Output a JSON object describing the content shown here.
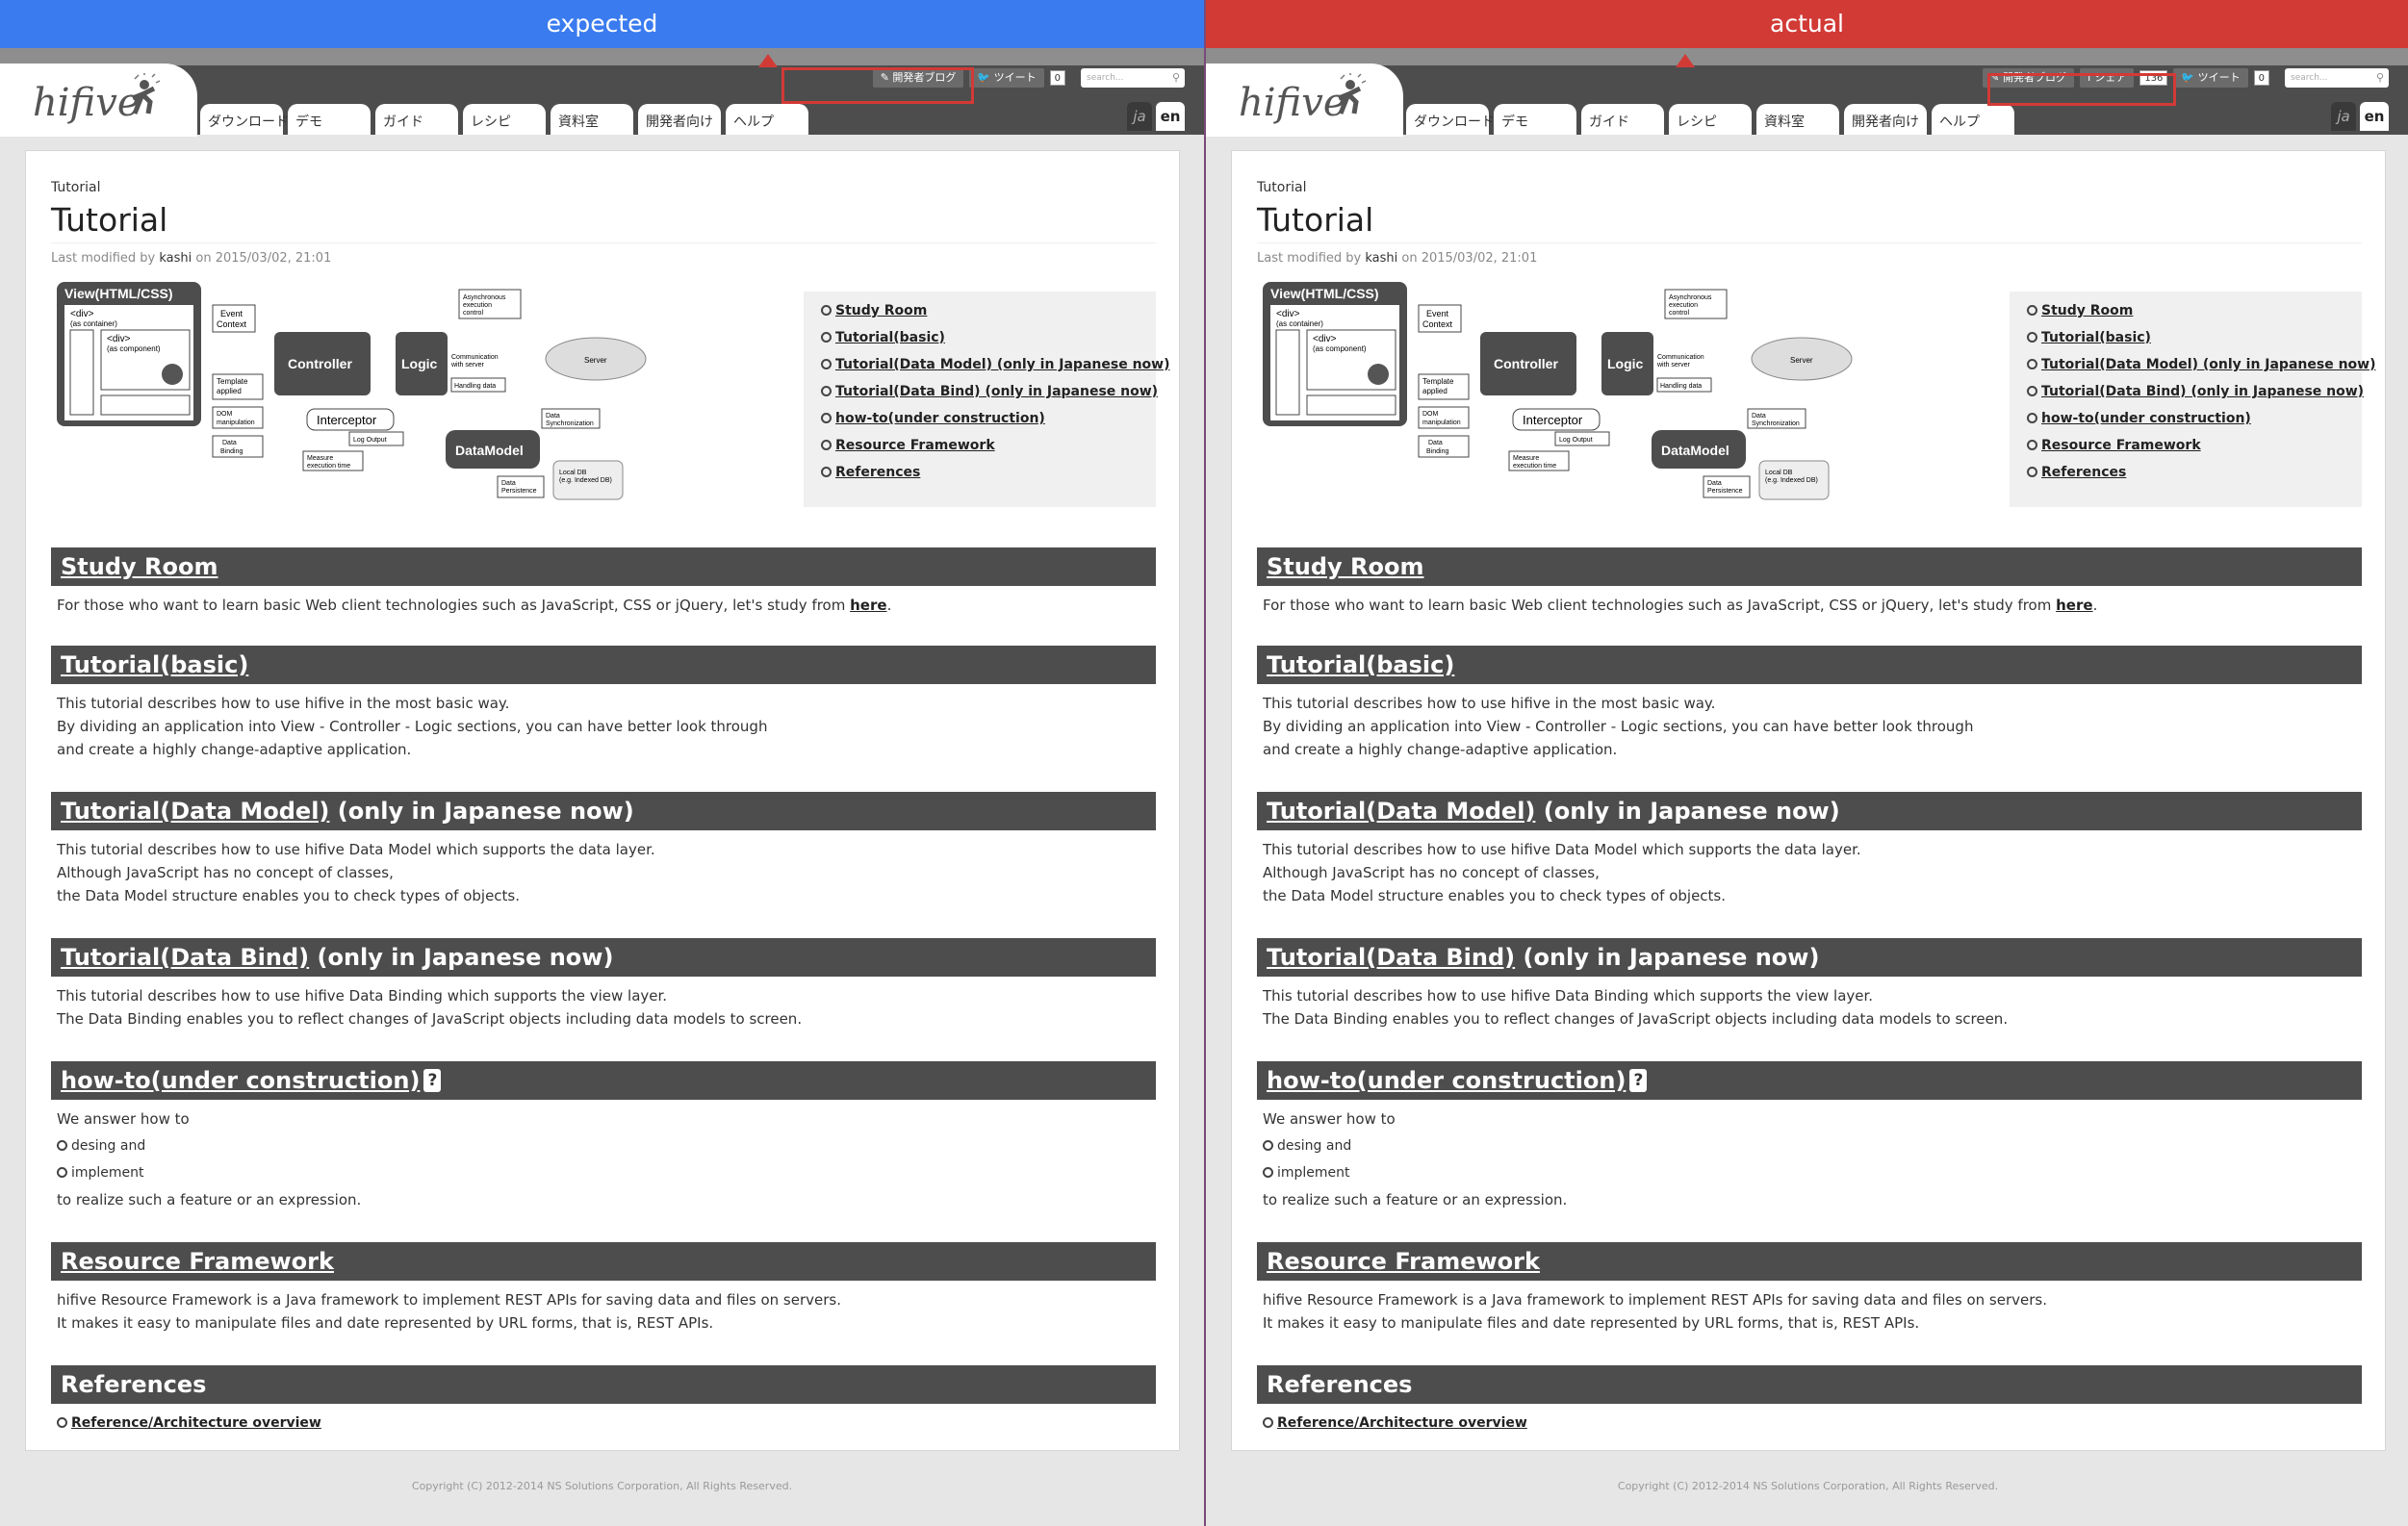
{
  "panes": {
    "left_label": "expected",
    "right_label": "actual"
  },
  "header": {
    "logo": "hifive",
    "nav": [
      "ダウンロード",
      "デモ",
      "ガイド",
      "レシピ",
      "資料室",
      "開発者向け",
      "ヘルプ"
    ],
    "lang_ja": "ja",
    "lang_en": "en",
    "dev_blog": "✎ 開発者ブログ",
    "share": "f シェア",
    "share_count": "136",
    "tweet": "ツイート",
    "tweet_count": "0",
    "search_placeholder": "search..."
  },
  "page": {
    "breadcrumb": "Tutorial",
    "title": "Tutorial",
    "modified_prefix": "Last modified by ",
    "user": "kashi",
    "modified_suffix": " on 2015/03/02, 21:01"
  },
  "toc": [
    "Study Room",
    "Tutorial(basic)",
    "Tutorial(Data Model) (only in Japanese now)",
    "Tutorial(Data Bind) (only in Japanese now)",
    "how-to(under construction)",
    "Resource Framework",
    "References"
  ],
  "diagram": {
    "view": "View(HTML/CSS)",
    "div1": "<div>",
    "div1b": "(as container)",
    "div2": "<div>",
    "div2b": "(as component)",
    "event": "Event",
    "context": "Context",
    "controller": "Controller",
    "logic": "Logic",
    "async1": "Asynchronous",
    "async2": "execution",
    "async3": "control",
    "template1": "Template",
    "template2": "applied",
    "dom1": "DOM",
    "dom2": "manipulation",
    "databind1": "Data",
    "databind2": "Binding",
    "interceptor": "Interceptor",
    "logout": "Log Output",
    "measure1": "Measure",
    "measure2": "execution time",
    "comm1": "Communication",
    "comm2": "with server",
    "handling": "Handling data",
    "server": "Server",
    "sync1": "Data",
    "sync2": "Synchronization",
    "datamodel": "DataModel",
    "persist1": "Data",
    "persist2": "Persistence",
    "localdb1": "Local DB",
    "localdb2": "(e.g. Indexed DB)"
  },
  "sections": {
    "study": {
      "title": "Study Room",
      "text": "For those who want to learn basic Web client technologies such as JavaScript, CSS or jQuery, let's study from ",
      "link": "here",
      "end": "."
    },
    "basic": {
      "title": "Tutorial(basic)",
      "l1": "This tutorial describes how to use hifive in the most basic way.",
      "l2": "By dividing an application into View - Controller - Logic sections, you can have better look through",
      "l3": "and create a highly change-adaptive application."
    },
    "model": {
      "title": "Tutorial(Data Model)",
      "suffix": " (only in Japanese now)",
      "l1": "This tutorial describes how to use hifive Data Model which supports the data layer.",
      "l2": "Although JavaScript has no concept of classes,",
      "l3": "the Data Model structure enables you to check types of objects."
    },
    "bind": {
      "title": "Tutorial(Data Bind)",
      "suffix": " (only in Japanese now)",
      "l1": "This tutorial describes how to use hifive Data Binding which supports the view layer.",
      "l2": "The Data Binding enables you to reflect changes of JavaScript objects including data models to screen."
    },
    "howto": {
      "title": "how-to(under construction)",
      "q": "?",
      "l1": "We answer how to",
      "i1": "desing and",
      "i2": "implement",
      "l2": "to realize such a feature or an expression."
    },
    "resource": {
      "title": "Resource Framework",
      "l1": "hifive Resource Framework is a Java framework to implement REST APIs for saving data and files on servers.",
      "l2": "It makes it easy to manipulate files and date represented by URL forms, that is, REST APIs."
    },
    "refs": {
      "title": "References",
      "link": "Reference/Architecture overview"
    }
  },
  "footer": "Copyright (C) 2012-2014 NS Solutions Corporation, All Rights Reserved.",
  "colors": {
    "expected": "#3a7bef",
    "actual": "#d23a36",
    "header": "#4d4d4d"
  }
}
